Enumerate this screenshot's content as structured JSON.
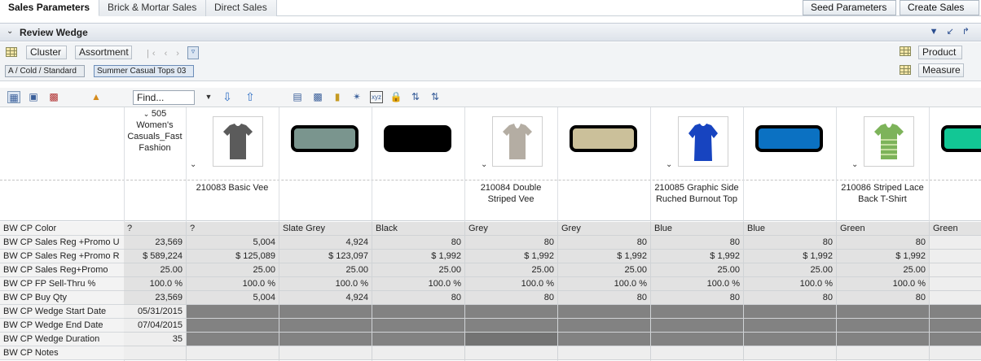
{
  "tabs": [
    "Sales Parameters",
    "Brick & Mortar Sales",
    "Direct Sales"
  ],
  "actions": {
    "seed": "Seed Parameters",
    "create": "Create Sales"
  },
  "wedge": {
    "title": "Review Wedge"
  },
  "dimensions": {
    "cluster": "Cluster",
    "assortment": "Assortment",
    "chip1": "A / Cold / Standard",
    "chip2": "Summer Casual Tops 03",
    "product": "Product",
    "measure": "Measure"
  },
  "toolbar": {
    "find_value": "Find..."
  },
  "cluster_header": {
    "line1": "505",
    "line2": "Women's",
    "line3": "Casuals_Fast",
    "line4": "Fashion"
  },
  "products": [
    {
      "name_line1": "210083 Basic Vee",
      "name_line2": "",
      "image": "t-shirt-dark-grey",
      "swatch_color": "#7a958e"
    },
    {
      "name_line1": "",
      "name_line2": "",
      "image": "",
      "swatch_color": "#000000"
    },
    {
      "name_line1": "210084 Double",
      "name_line2": "Striped Vee",
      "image": "t-shirt-light-grey",
      "swatch_color": "#cbc09a"
    },
    {
      "name_line1": "",
      "name_line2": "",
      "image": "",
      "swatch_color": "#0b71c2"
    },
    {
      "name_line1": "210085 Graphic Side",
      "name_line2": "Ruched Burnout Top",
      "image": "t-shirt-blue",
      "swatch_color": "#12c795"
    },
    {
      "name_line1": "",
      "name_line2": "",
      "image": "",
      "swatch_color": ""
    },
    {
      "name_line1": "210086 Striped Lace",
      "name_line2": "Back T-Shirt",
      "image": "t-shirt-green",
      "swatch_color": ""
    }
  ],
  "row_labels": [
    "BW CP Color",
    "BW CP Sales Reg +Promo U",
    "BW CP Sales Reg +Promo R",
    "BW CP Sales Reg+Promo",
    "BW CP FP Sell-Thru %",
    "BW CP Buy Qty",
    "BW CP Wedge Start Date",
    "BW CP Wedge End Date",
    "BW CP Wedge Duration",
    "BW CP Notes"
  ],
  "rows": [
    [
      "?",
      "?",
      "Slate Grey",
      "Black",
      "Grey",
      "Grey",
      "Blue",
      "Blue",
      "Green",
      "Green"
    ],
    [
      "23,569",
      "5,004",
      "4,924",
      "80",
      "80",
      "80",
      "80",
      "80",
      "80",
      ""
    ],
    [
      "$ 589,224",
      "$ 125,089",
      "$ 123,097",
      "$ 1,992",
      "$ 1,992",
      "$ 1,992",
      "$ 1,992",
      "$ 1,992",
      "$ 1,992",
      ""
    ],
    [
      "25.00",
      "25.00",
      "25.00",
      "25.00",
      "25.00",
      "25.00",
      "25.00",
      "25.00",
      "25.00",
      ""
    ],
    [
      "100.0 %",
      "100.0 %",
      "100.0 %",
      "100.0 %",
      "100.0 %",
      "100.0 %",
      "100.0 %",
      "100.0 %",
      "100.0 %",
      ""
    ],
    [
      "23,569",
      "5,004",
      "4,924",
      "80",
      "80",
      "80",
      "80",
      "80",
      "80",
      ""
    ],
    [
      "05/31/2015",
      "",
      "",
      "",
      "",
      "",
      "",
      "",
      "",
      ""
    ],
    [
      "07/04/2015",
      "",
      "",
      "",
      "",
      "",
      "",
      "",
      "",
      ""
    ],
    [
      "35",
      "",
      "",
      "",
      "",
      "",
      "",
      "",
      "",
      ""
    ],
    [
      "",
      "",
      "",
      "",
      "",
      "",
      "",
      "",
      "",
      ""
    ]
  ]
}
